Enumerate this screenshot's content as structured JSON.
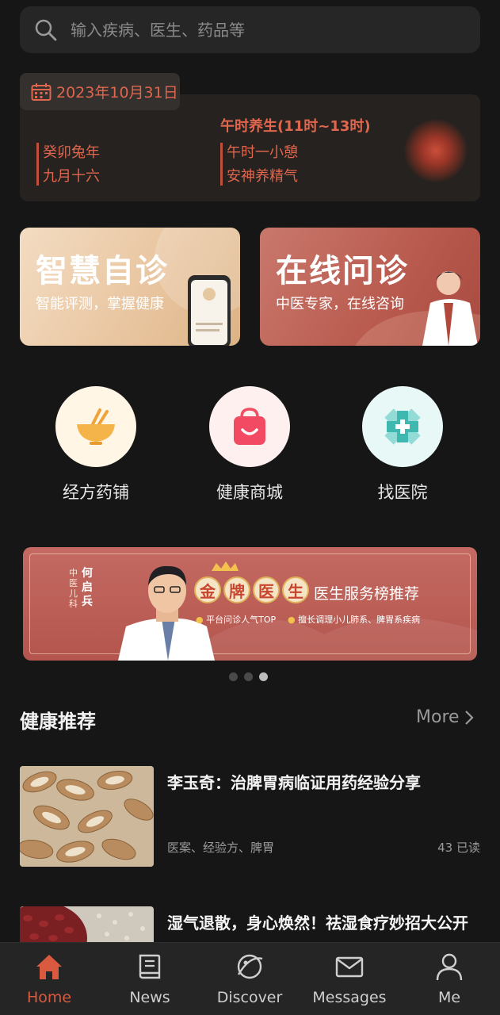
{
  "search": {
    "placeholder": "输入疾病、医生、药品等"
  },
  "calendar": {
    "date": "2023年10月31日",
    "period_title": "午时养生(11时~13时)",
    "lunar_year": "癸卯兔年",
    "lunar_day": "九月十六",
    "tip_1": "午时一小憩",
    "tip_2": "安神养精气"
  },
  "feature_cards": [
    {
      "title": "智慧自诊",
      "subtitle": "智能评测，掌握健康"
    },
    {
      "title": "在线问诊",
      "subtitle": "中医专家，在线咨询"
    }
  ],
  "services": [
    {
      "label": "经方药铺",
      "icon": "herbal-bowl-icon"
    },
    {
      "label": "健康商城",
      "icon": "shopping-bag-icon"
    },
    {
      "label": "找医院",
      "icon": "hospital-cross-icon"
    }
  ],
  "banner": {
    "doctor_name": "何启兵",
    "doctor_dept": "中医儿科",
    "badge_chars": [
      "金",
      "牌",
      "医",
      "生"
    ],
    "headline": "医生服务榜推荐",
    "point_1": "平台问诊人气TOP",
    "point_2": "擅长调理小儿肺系、脾胃系疾病"
  },
  "carousel": {
    "total": 3,
    "active": 3
  },
  "section": {
    "title": "健康推荐",
    "more_label": "More"
  },
  "articles": [
    {
      "title": "李玉奇：治脾胃病临证用药经验分享",
      "tags": "医案、经验方、脾胃",
      "reads": "43 已读"
    },
    {
      "title": "湿气退散，身心焕然！祛湿食疗妙招大公开",
      "tags": "",
      "reads": ""
    }
  ],
  "tabbar": [
    {
      "label": "Home",
      "icon": "home-icon",
      "active": true
    },
    {
      "label": "News",
      "icon": "book-icon",
      "active": false
    },
    {
      "label": "Discover",
      "icon": "planet-icon",
      "active": false
    },
    {
      "label": "Messages",
      "icon": "mail-icon",
      "active": false
    },
    {
      "label": "Me",
      "icon": "user-icon",
      "active": false
    }
  ],
  "colors": {
    "accent": "#d95a3f",
    "background": "#161616"
  }
}
